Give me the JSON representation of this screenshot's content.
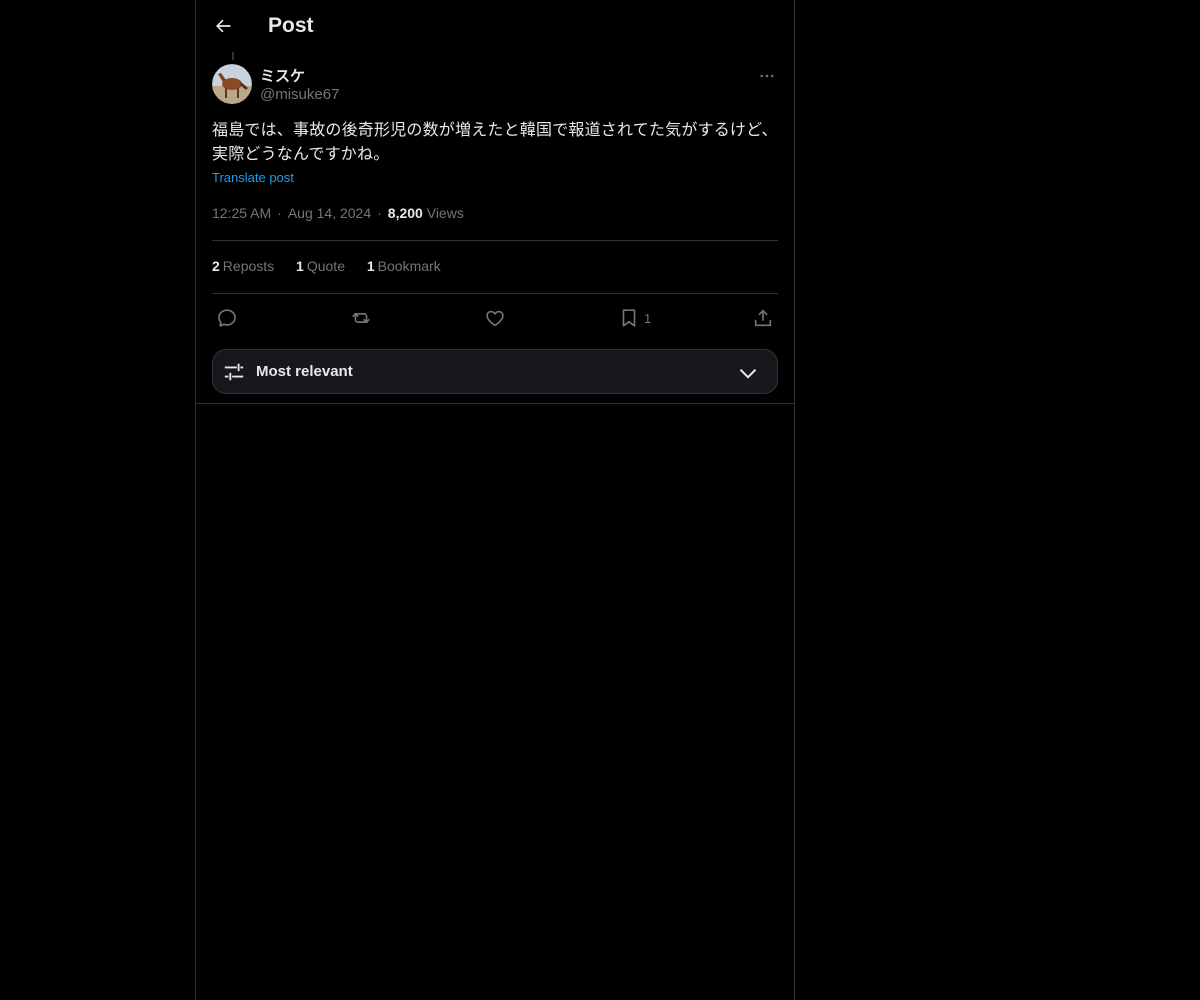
{
  "header": {
    "title": "Post"
  },
  "post": {
    "author_name": "ミスケ",
    "author_handle": "@misuke67",
    "text": "福島では、事故の後奇形児の数が増えたと韓国で報道されてた気がするけど、実際どうなんですかね。",
    "translate_label": "Translate post",
    "time": "12:25 AM",
    "date": "Aug 14, 2024",
    "views_count": "8,200",
    "views_label": "Views",
    "meta_separator": "·"
  },
  "stats": {
    "reposts_count": "2",
    "reposts_label": "Reposts",
    "quote_count": "1",
    "quote_label": "Quote",
    "bookmark_count": "1",
    "bookmark_label": "Bookmark"
  },
  "actions": {
    "bookmark_count": "1"
  },
  "sort": {
    "label": "Most relevant"
  },
  "colors": {
    "accent": "#1d9bf0",
    "muted": "#71767b",
    "text": "#e7e9ea",
    "border": "#2f3336"
  }
}
